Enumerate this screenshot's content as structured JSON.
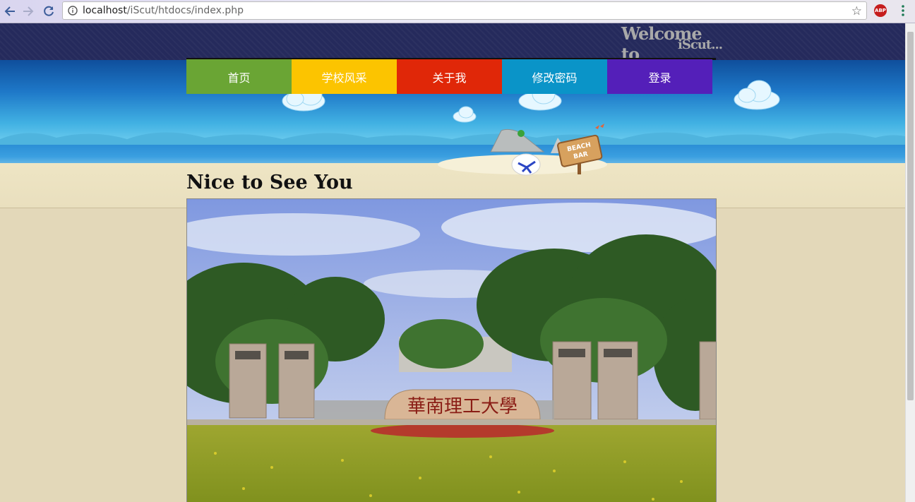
{
  "browser": {
    "url_host": "localhost",
    "url_path": "/iScut/htdocs/index.php",
    "abp_label": "ABP",
    "icons": [
      "back-icon",
      "forward-icon",
      "reload-icon",
      "info-icon",
      "star-icon",
      "abp-icon",
      "menu-icon"
    ]
  },
  "header": {
    "welcome_line1": "Welcome to",
    "welcome_line2": "iScut..."
  },
  "menu": {
    "items": [
      {
        "label": "首页",
        "color": "#6aa534"
      },
      {
        "label": "学校风采",
        "color": "#fcc400"
      },
      {
        "label": "关于我",
        "color": "#e02708"
      },
      {
        "label": "修改密码",
        "color": "#0a94c8"
      },
      {
        "label": "登录",
        "color": "#541fb9"
      }
    ]
  },
  "decor": {
    "beach_sign_line1": "BEACH",
    "beach_sign_line2": "BAR"
  },
  "main": {
    "heading": "Nice to See You",
    "campus_stone_text": "華南理工大學"
  },
  "colors": {
    "topbar": "#252a5c",
    "sky_top": "#0f4f9c",
    "sand": "#e3d8b9"
  }
}
